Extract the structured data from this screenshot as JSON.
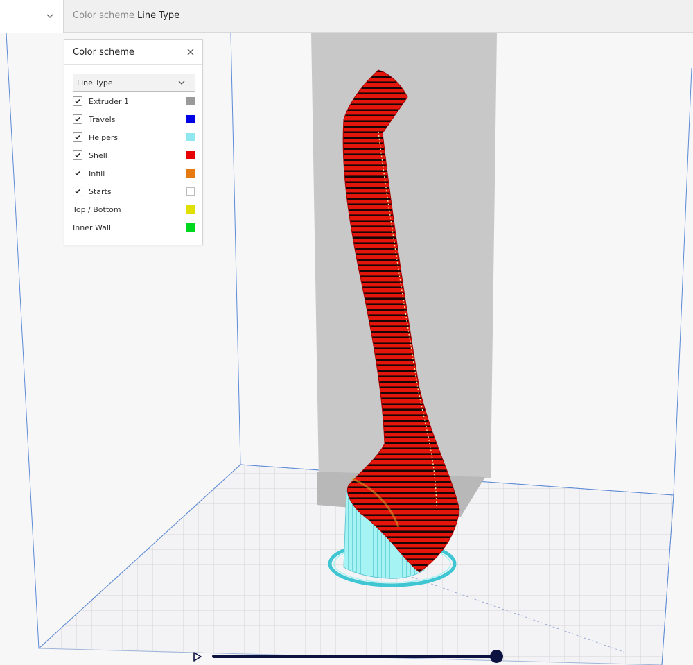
{
  "header": {
    "color_scheme_label": "Color scheme",
    "color_scheme_value": "Line Type"
  },
  "panel": {
    "title": "Color scheme",
    "selected_scheme": "Line Type",
    "items": [
      {
        "label": "Extruder 1",
        "checked": true,
        "color": "#9a9a9a"
      },
      {
        "label": "Travels",
        "checked": true,
        "color": "#0000e6"
      },
      {
        "label": "Helpers",
        "checked": true,
        "color": "#8fe8f0"
      },
      {
        "label": "Shell",
        "checked": true,
        "color": "#e60000"
      },
      {
        "label": "Infill",
        "checked": true,
        "color": "#e67a10"
      },
      {
        "label": "Starts",
        "checked": true,
        "color": "#ffffff"
      },
      {
        "label": "Top / Bottom",
        "checked": null,
        "color": "#e0e000"
      },
      {
        "label": "Inner Wall",
        "checked": null,
        "color": "#00d820"
      }
    ]
  },
  "playback": {
    "progress": 1.0
  },
  "colors": {
    "accent": "#0c1340",
    "shell": "#e60000",
    "helpers": "#8fe8f0",
    "shadow": "#c8c8c8"
  }
}
